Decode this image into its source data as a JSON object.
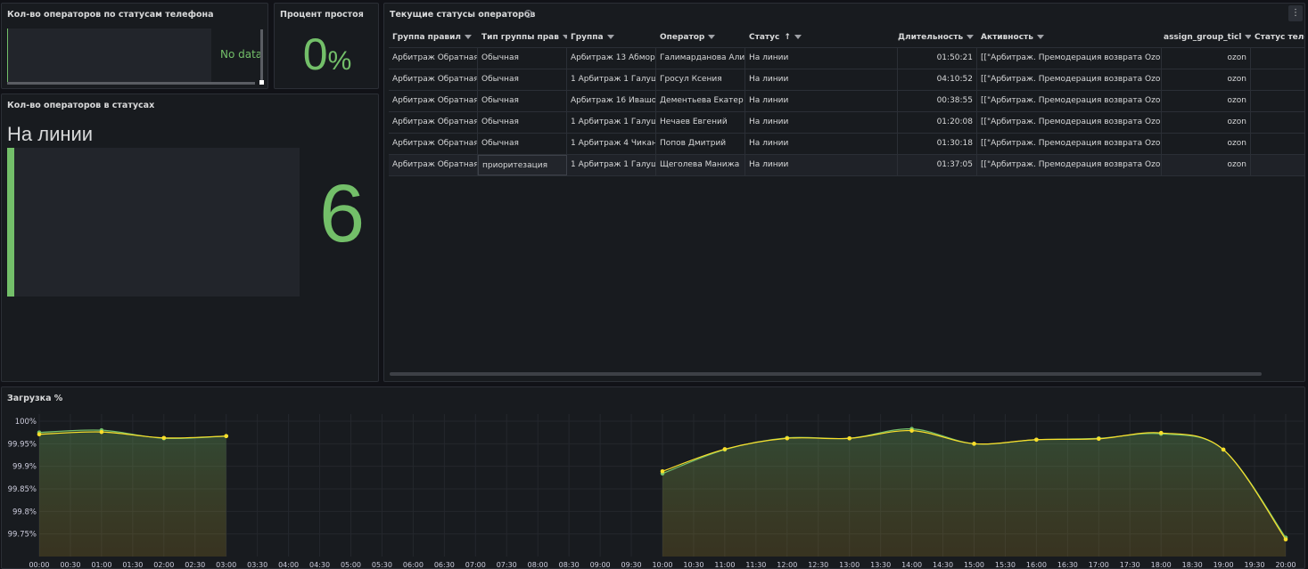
{
  "panels": {
    "phone_status": {
      "title": "Кол-во операторов по статусам телефона",
      "message": "No data"
    },
    "idle_percent": {
      "title": "Процент простоя",
      "value": "0",
      "unit": "%"
    },
    "operators_in_status": {
      "title": "Кол-во операторов в статусах",
      "status_name": "На линии",
      "count": "6"
    },
    "current_statuses": {
      "title": "Текущие статусы операторов",
      "info_icon": "info-icon",
      "menu_icon": "kebab-menu-icon",
      "columns": [
        "Группа правил",
        "Тип группы прав",
        "Группа",
        "Оператор",
        "Статус",
        "Длительность",
        "Активность",
        "assign_group_ticl",
        "Статус теле"
      ],
      "sorted_column_arrow": "↑",
      "rows": [
        [
          "Арбитраж Обратная",
          "Обычная",
          "Арбитраж 13 Абмор",
          "Галимарданова Али",
          "На линии",
          "01:50:21",
          "[[\"Арбитраж. Премодерация возврата Ozon",
          "ozon",
          ""
        ],
        [
          "Арбитраж Обратная",
          "Обычная",
          "1 Арбитраж 1 Галуш",
          "Гросул Ксения",
          "На линии",
          "04:10:52",
          "[[\"Арбитраж. Премодерация возврата Ozon",
          "ozon",
          ""
        ],
        [
          "Арбитраж Обратная",
          "Обычная",
          "Арбитраж 16 Ивашо",
          "Дементьева Екатер",
          "На линии",
          "00:38:55",
          "[[\"Арбитраж. Премодерация возврата Ozon",
          "ozon",
          ""
        ],
        [
          "Арбитраж Обратная",
          "Обычная",
          "1 Арбитраж 1 Галуш",
          "Нечаев Евгений",
          "На линии",
          "01:20:08",
          "[[\"Арбитраж. Премодерация возврата Ozon",
          "ozon",
          ""
        ],
        [
          "Арбитраж Обратная",
          "Обычная",
          "1 Арбитраж 4 Чикан",
          "Попов Дмитрий",
          "На линии",
          "01:30:18",
          "[[\"Арбитраж. Премодерация возврата Ozon",
          "ozon",
          ""
        ],
        [
          "Арбитраж Обратная",
          "приоритезация",
          "1 Арбитраж 1 Галуш",
          "Щеголева Манижа",
          "На линии",
          "01:37:05",
          "[[\"Арбитраж. Премодерация возврата Ozon",
          "ozon",
          ""
        ]
      ]
    },
    "load": {
      "title": "Загрузка %"
    }
  },
  "colors": {
    "green": "#73bf69",
    "yellow": "#fade2a",
    "panel_bg": "#181b1f",
    "page_bg": "#111217"
  },
  "chart_data": {
    "type": "area",
    "title": "Загрузка %",
    "x_ticks": [
      "00:00",
      "00:30",
      "01:00",
      "01:30",
      "02:00",
      "02:30",
      "03:00",
      "03:30",
      "04:00",
      "04:30",
      "05:00",
      "05:30",
      "06:00",
      "06:30",
      "07:00",
      "07:30",
      "08:00",
      "08:30",
      "09:00",
      "09:30",
      "10:00",
      "10:30",
      "11:00",
      "11:30",
      "12:00",
      "12:30",
      "13:00",
      "13:30",
      "14:00",
      "14:30",
      "15:00",
      "15:30",
      "16:00",
      "16:30",
      "17:00",
      "17:30",
      "18:00",
      "18:30",
      "19:00",
      "19:30",
      "20:00"
    ],
    "y_ticks": [
      "100%",
      "99.95%",
      "99.9%",
      "99.85%",
      "99.8%",
      "99.75%"
    ],
    "ylim": [
      99.7,
      100
    ],
    "xlim_hours": [
      0,
      20
    ],
    "series": [
      {
        "color": "#73bf69",
        "segments": [
          [
            [
              0,
              99.975
            ],
            [
              1,
              99.98
            ],
            [
              2,
              99.962
            ],
            [
              3,
              99.967
            ]
          ],
          [
            [
              10,
              99.884
            ],
            [
              11,
              99.937
            ],
            [
              12,
              99.963
            ],
            [
              13,
              99.962
            ],
            [
              14,
              99.983
            ],
            [
              15,
              99.95
            ],
            [
              16,
              99.959
            ],
            [
              17,
              99.962
            ],
            [
              18,
              99.972
            ],
            [
              19,
              99.937
            ],
            [
              20,
              99.742
            ]
          ]
        ]
      },
      {
        "color": "#fade2a",
        "segments": [
          [
            [
              0,
              99.971
            ],
            [
              1,
              99.976
            ],
            [
              2,
              99.963
            ],
            [
              3,
              99.967
            ]
          ],
          [
            [
              10,
              99.889
            ],
            [
              11,
              99.938
            ],
            [
              12,
              99.962
            ],
            [
              13,
              99.962
            ],
            [
              14,
              99.979
            ],
            [
              15,
              99.95
            ],
            [
              16,
              99.959
            ],
            [
              17,
              99.961
            ],
            [
              18,
              99.974
            ],
            [
              19,
              99.937
            ],
            [
              20,
              99.738
            ]
          ]
        ]
      }
    ],
    "grid": true
  }
}
